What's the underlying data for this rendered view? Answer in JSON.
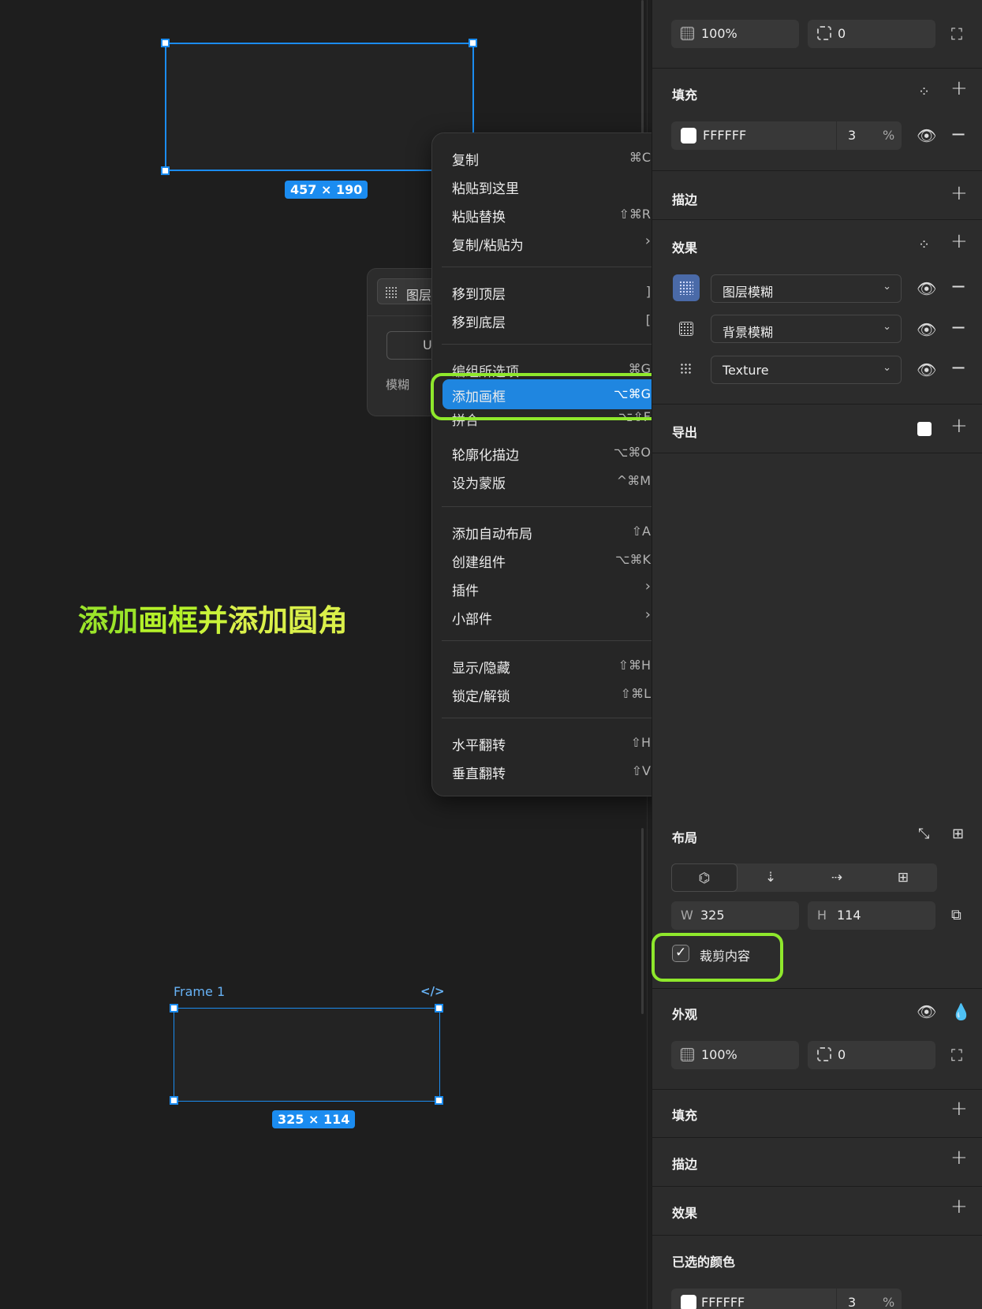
{
  "canvas": {
    "top_rect_size": "457 × 190",
    "overlay_text_parts": [
      "添加",
      "画框",
      "并",
      "添加圆角"
    ],
    "frame_name": "Frame 1",
    "frame_code_icon": "code-icon",
    "frame_size": "325 × 114",
    "background_panel": {
      "field_label": "图层",
      "button_label": "U",
      "blur_label": "模糊"
    }
  },
  "context_menu": {
    "groups": [
      [
        {
          "label": "复制",
          "shortcut": "⌘C"
        },
        {
          "label": "粘贴到这里",
          "shortcut": ""
        },
        {
          "label": "粘贴替换",
          "shortcut": "⇧⌘R"
        },
        {
          "label": "复制/粘贴为",
          "shortcut": "›"
        }
      ],
      [
        {
          "label": "移到顶层",
          "shortcut": "]"
        },
        {
          "label": "移到底层",
          "shortcut": "["
        }
      ],
      [
        {
          "label": "编组所选项",
          "shortcut": "⌘G"
        },
        {
          "label": "添加画框",
          "shortcut": "⌥⌘G"
        },
        {
          "label": "拼合",
          "shortcut": "⌥⇧F"
        },
        {
          "label": "轮廓化描边",
          "shortcut": "⌥⌘O"
        },
        {
          "label": "设为蒙版",
          "shortcut": "^⌘M"
        }
      ],
      [
        {
          "label": "添加自动布局",
          "shortcut": "⇧A"
        },
        {
          "label": "创建组件",
          "shortcut": "⌥⌘K"
        },
        {
          "label": "插件",
          "shortcut": "›"
        },
        {
          "label": "小部件",
          "shortcut": "›"
        }
      ],
      [
        {
          "label": "显示/隐藏",
          "shortcut": "⇧⌘H"
        },
        {
          "label": "锁定/解锁",
          "shortcut": "⇧⌘L"
        }
      ],
      [
        {
          "label": "水平翻转",
          "shortcut": "⇧H"
        },
        {
          "label": "垂直翻转",
          "shortcut": "⇧V"
        }
      ]
    ],
    "highlighted": "添加画框"
  },
  "panel_top": {
    "opacity": "100%",
    "radius": "0",
    "fill_title": "填充",
    "fill_color": "FFFFFF",
    "fill_opacity": "3",
    "fill_percent": "%",
    "stroke_title": "描边",
    "effects_title": "效果",
    "effects": [
      {
        "label": "图层模糊",
        "icon": "layer-blur-icon"
      },
      {
        "label": "背景模糊",
        "icon": "background-blur-icon"
      },
      {
        "label": "Texture",
        "icon": "texture-icon"
      }
    ],
    "export_title": "导出"
  },
  "panel_bottom": {
    "layout_title": "布局",
    "layout_modes": [
      "free-layout-icon",
      "vertical-layout-icon",
      "horizontal-layout-icon",
      "grid-layout-icon"
    ],
    "w_label": "W",
    "w_value": "325",
    "h_label": "H",
    "h_value": "114",
    "clip_label": "裁剪内容",
    "clip_checked": true,
    "appearance_title": "外观",
    "opacity": "100%",
    "radius": "0",
    "fill_title": "填充",
    "stroke_title": "描边",
    "effects_title": "效果",
    "selected_colors_title": "已选的颜色",
    "selected_color": "FFFFFF",
    "selected_opacity": "3",
    "selected_percent": "%"
  },
  "colors": {
    "accent": "#1b8cf0",
    "highlight_ring": "#8fe82c",
    "overlay_text": "#b4f02a"
  }
}
